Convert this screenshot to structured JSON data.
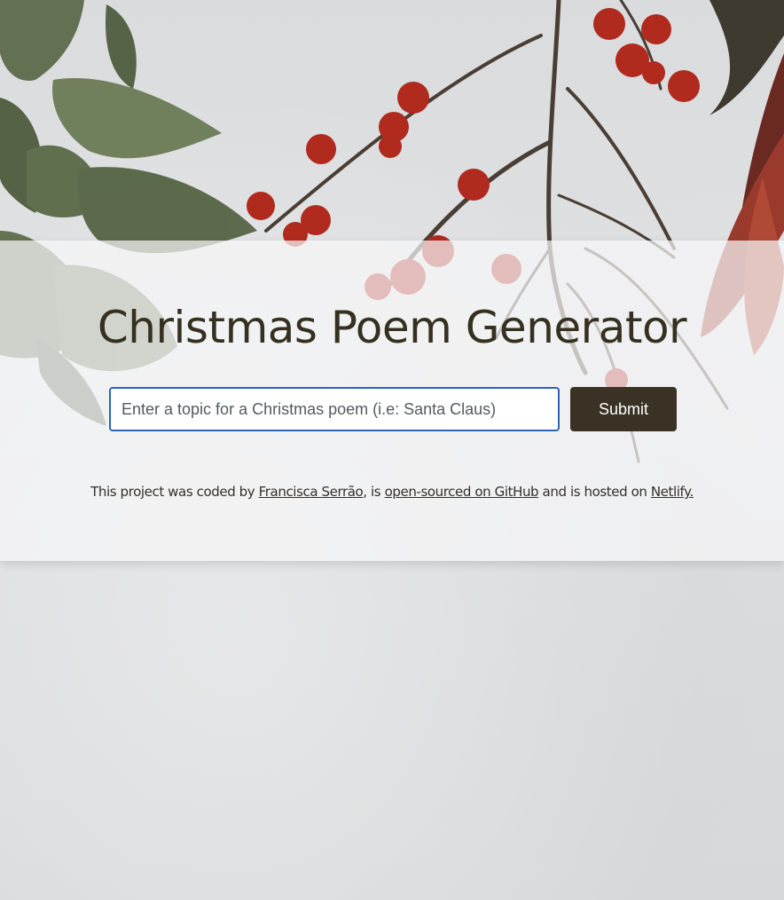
{
  "page": {
    "title": "Christmas Poem Generator"
  },
  "form": {
    "placeholder": "Enter a topic for a Christmas poem (i.e: Santa Claus)",
    "value": "",
    "submit_label": "Submit"
  },
  "footer": {
    "text_1": "This project was coded by ",
    "author_link": "Francisca Serrão",
    "text_2": ", is ",
    "github_link": "open-sourced on GitHub",
    "text_3": " and is hosted on ",
    "netlify_link": "Netlify."
  },
  "colors": {
    "accent": "#3a3325",
    "input_border": "#2d63b8",
    "title": "#35301f"
  }
}
